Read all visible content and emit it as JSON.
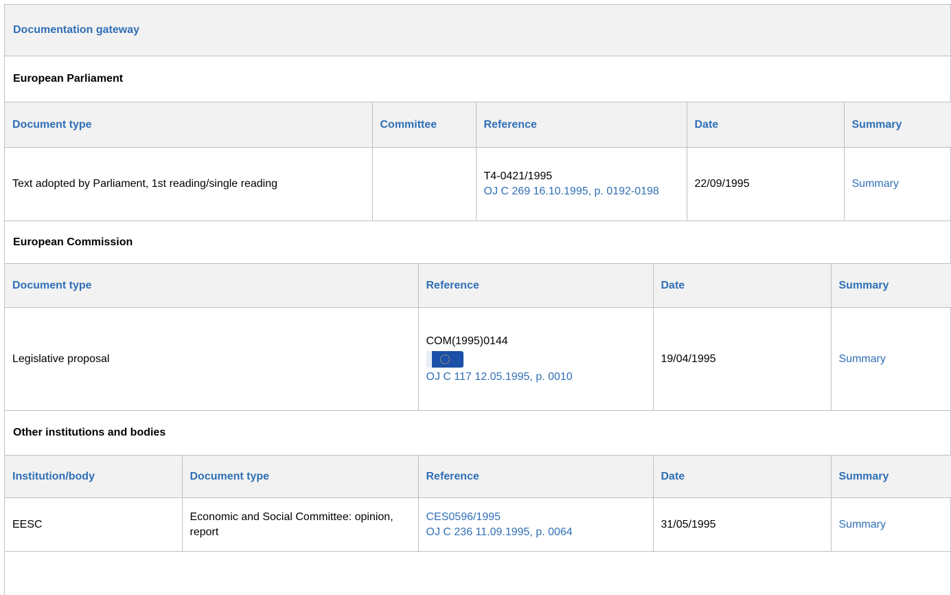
{
  "gateway": {
    "title": "Documentation gateway"
  },
  "parliament": {
    "title": "European Parliament",
    "headers": [
      "Document type",
      "Committee",
      "Reference",
      "Date",
      "Summary"
    ],
    "rows": [
      {
        "doc_type": "Text adopted by Parliament, 1st reading/single reading",
        "committee": "",
        "reference": "T4-0421/1995",
        "oj_link": "OJ C 269 16.10.1995, p. 0192-0198",
        "date": "22/09/1995",
        "summary": "Summary"
      }
    ]
  },
  "commission": {
    "title": "European Commission",
    "headers": [
      "Document type",
      "Reference",
      "Date",
      "Summary"
    ],
    "rows": [
      {
        "doc_type": "Legislative proposal",
        "reference": "COM(1995)0144",
        "flag_icon": "eu-flag-icon",
        "oj_link": "OJ C 117 12.05.1995, p. 0010",
        "date": "19/04/1995",
        "summary": "Summary"
      }
    ]
  },
  "other": {
    "title": "Other institutions and bodies",
    "headers": [
      "Institution/body",
      "Document type",
      "Reference",
      "Date",
      "Summary"
    ],
    "rows": [
      {
        "institution": "EESC",
        "doc_type": "Economic and Social Committee: opinion, report",
        "reference_link": "CES0596/1995",
        "oj_link": "OJ C 236 11.09.1995, p. 0064",
        "date": "31/05/1995",
        "summary": "Summary"
      }
    ]
  },
  "colors": {
    "link": "#2f6fb6",
    "header_bg": "#f2f2f2",
    "border": "#bfbfbf"
  }
}
